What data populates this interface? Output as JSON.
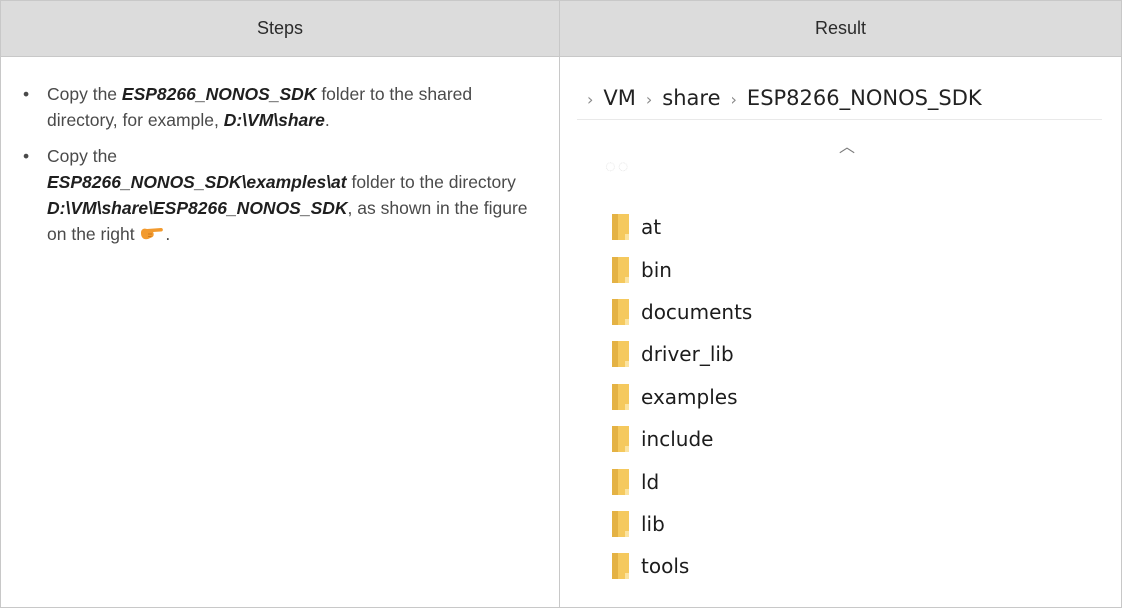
{
  "header": {
    "steps_label": "Steps",
    "result_label": "Result"
  },
  "steps": {
    "step1": {
      "t1": "Copy the ",
      "b1": "ESP8266_NONOS_SDK",
      "t2": " folder to the shared directory, for example, ",
      "b2": "D:\\VM\\share",
      "t3": "."
    },
    "step2": {
      "t1": "Copy the ",
      "b1": "ESP8266_NONOS_SDK\\examples\\at",
      "t2": " folder to the directory ",
      "b2": "D:\\VM\\share\\ESP8266_NONOS_SDK",
      "t3": ", as shown in the figure on the right ",
      "t4": "."
    }
  },
  "explorer": {
    "breadcrumb": [
      "VM",
      "share",
      "ESP8266_NONOS_SDK"
    ],
    "folders": [
      "at",
      "bin",
      "documents",
      "driver_lib",
      "examples",
      "include",
      "ld",
      "lib",
      "tools"
    ]
  },
  "icons": {
    "pointer": "hand-pointing-right-icon",
    "folder": "folder-icon",
    "caret": "chevron-up-icon",
    "separator": "chevron-right-icon"
  },
  "colors": {
    "header_bg": "#dcdcdc",
    "folder_yellow": "#f5c95e",
    "pointer_orange": "#f29a2e"
  }
}
